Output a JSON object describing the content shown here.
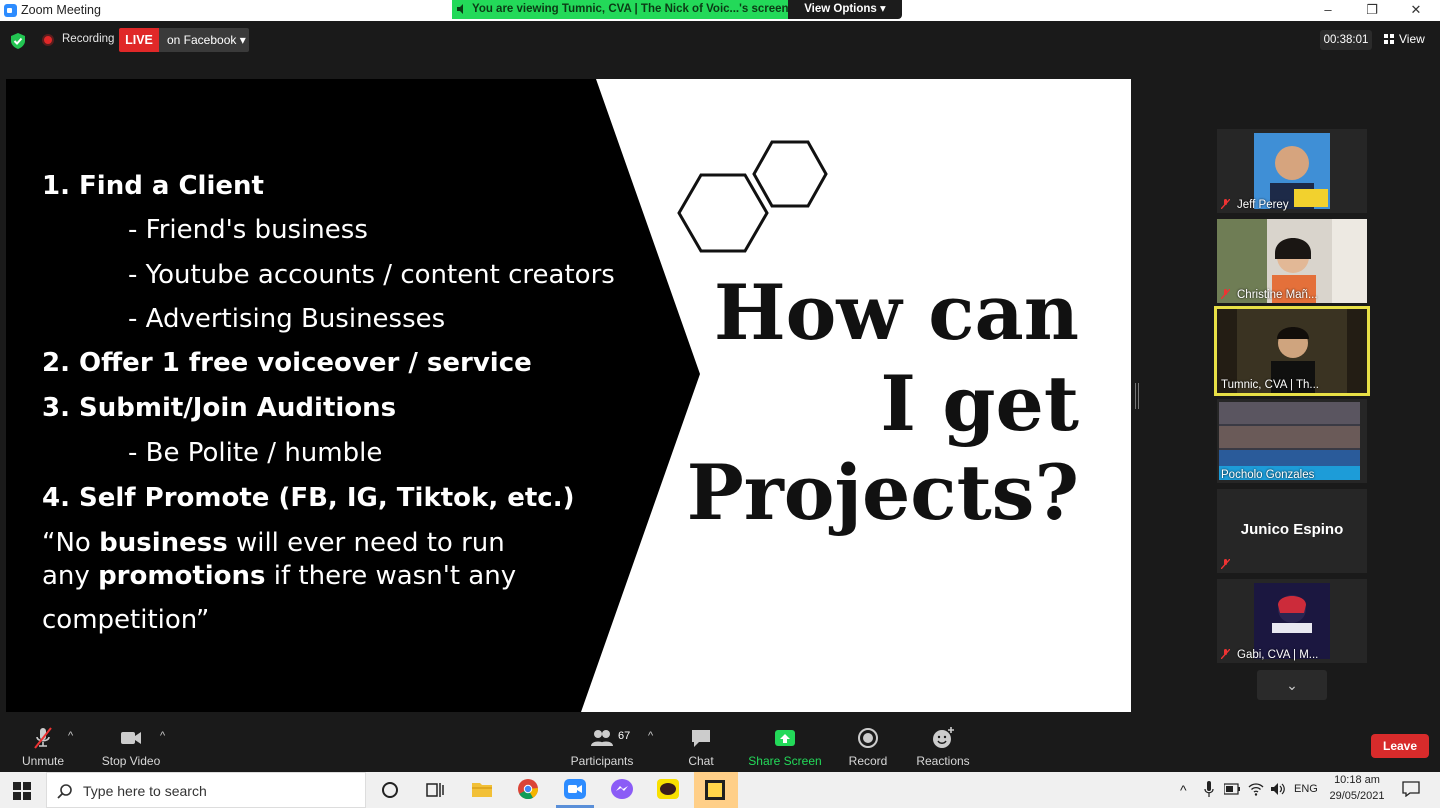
{
  "window": {
    "title": "Zoom Meeting",
    "minimize": "–",
    "restore": "❐",
    "close": "✕"
  },
  "banner": {
    "viewing": "You are viewing Tumnic, CVA | The Nick of Voic...'s screen",
    "view_options": "View Options ▾"
  },
  "topbar": {
    "recording": "Recording",
    "live": "LIVE",
    "live_target": "on Facebook ▾",
    "timer": "00:38:01",
    "view": "View"
  },
  "slide": {
    "lines": [
      {
        "text": "1.   Find a Client",
        "bold": true
      },
      {
        "text": "- Friend's business",
        "bold": false
      },
      {
        "text": "- Youtube accounts / content creators",
        "bold": false
      },
      {
        "text": "- Advertising Businesses",
        "bold": false
      },
      {
        "text": "2.   Offer 1 free voiceover / service",
        "bold": true
      },
      {
        "text": "3.   Submit/Join Auditions",
        "bold": true
      },
      {
        "text": "- Be Polite / humble",
        "bold": false
      },
      {
        "text": "4.    Self Promote (FB, IG, Tiktok, etc.)",
        "bold": true
      }
    ],
    "quote_1a": "“No ",
    "quote_1b": "business",
    "quote_1c": " will ever need to run",
    "quote_2a": "any ",
    "quote_2b": "promotions",
    "quote_2c": " if there wasn't any",
    "quote_3": "competition”",
    "headline_1": "How can",
    "headline_2": "I get",
    "headline_3": "Projects?"
  },
  "gallery": [
    {
      "name": "Jeff Perey",
      "muted": true,
      "active": false
    },
    {
      "name": "Christine Mañ...",
      "muted": true,
      "active": false
    },
    {
      "name": "Tumnic, CVA | Th...",
      "muted": false,
      "active": true
    },
    {
      "name": "Pocholo Gonzales",
      "muted": false,
      "active": false
    },
    {
      "name": "Junico Espino",
      "muted": true,
      "active": false
    },
    {
      "name": "Gabi, CVA | M...",
      "muted": true,
      "active": false
    }
  ],
  "toolbar": {
    "unmute": "Unmute",
    "stop_video": "Stop Video",
    "participants": "Participants",
    "participants_count": "67",
    "chat": "Chat",
    "share_screen": "Share Screen",
    "record": "Record",
    "reactions": "Reactions",
    "leave": "Leave",
    "accent_green": "#23d959",
    "leave_red": "#d82b2b"
  },
  "taskbar": {
    "search_placeholder": "Type here to search",
    "lang": "ENG",
    "time": "10:18 am",
    "date": "29/05/2021"
  }
}
